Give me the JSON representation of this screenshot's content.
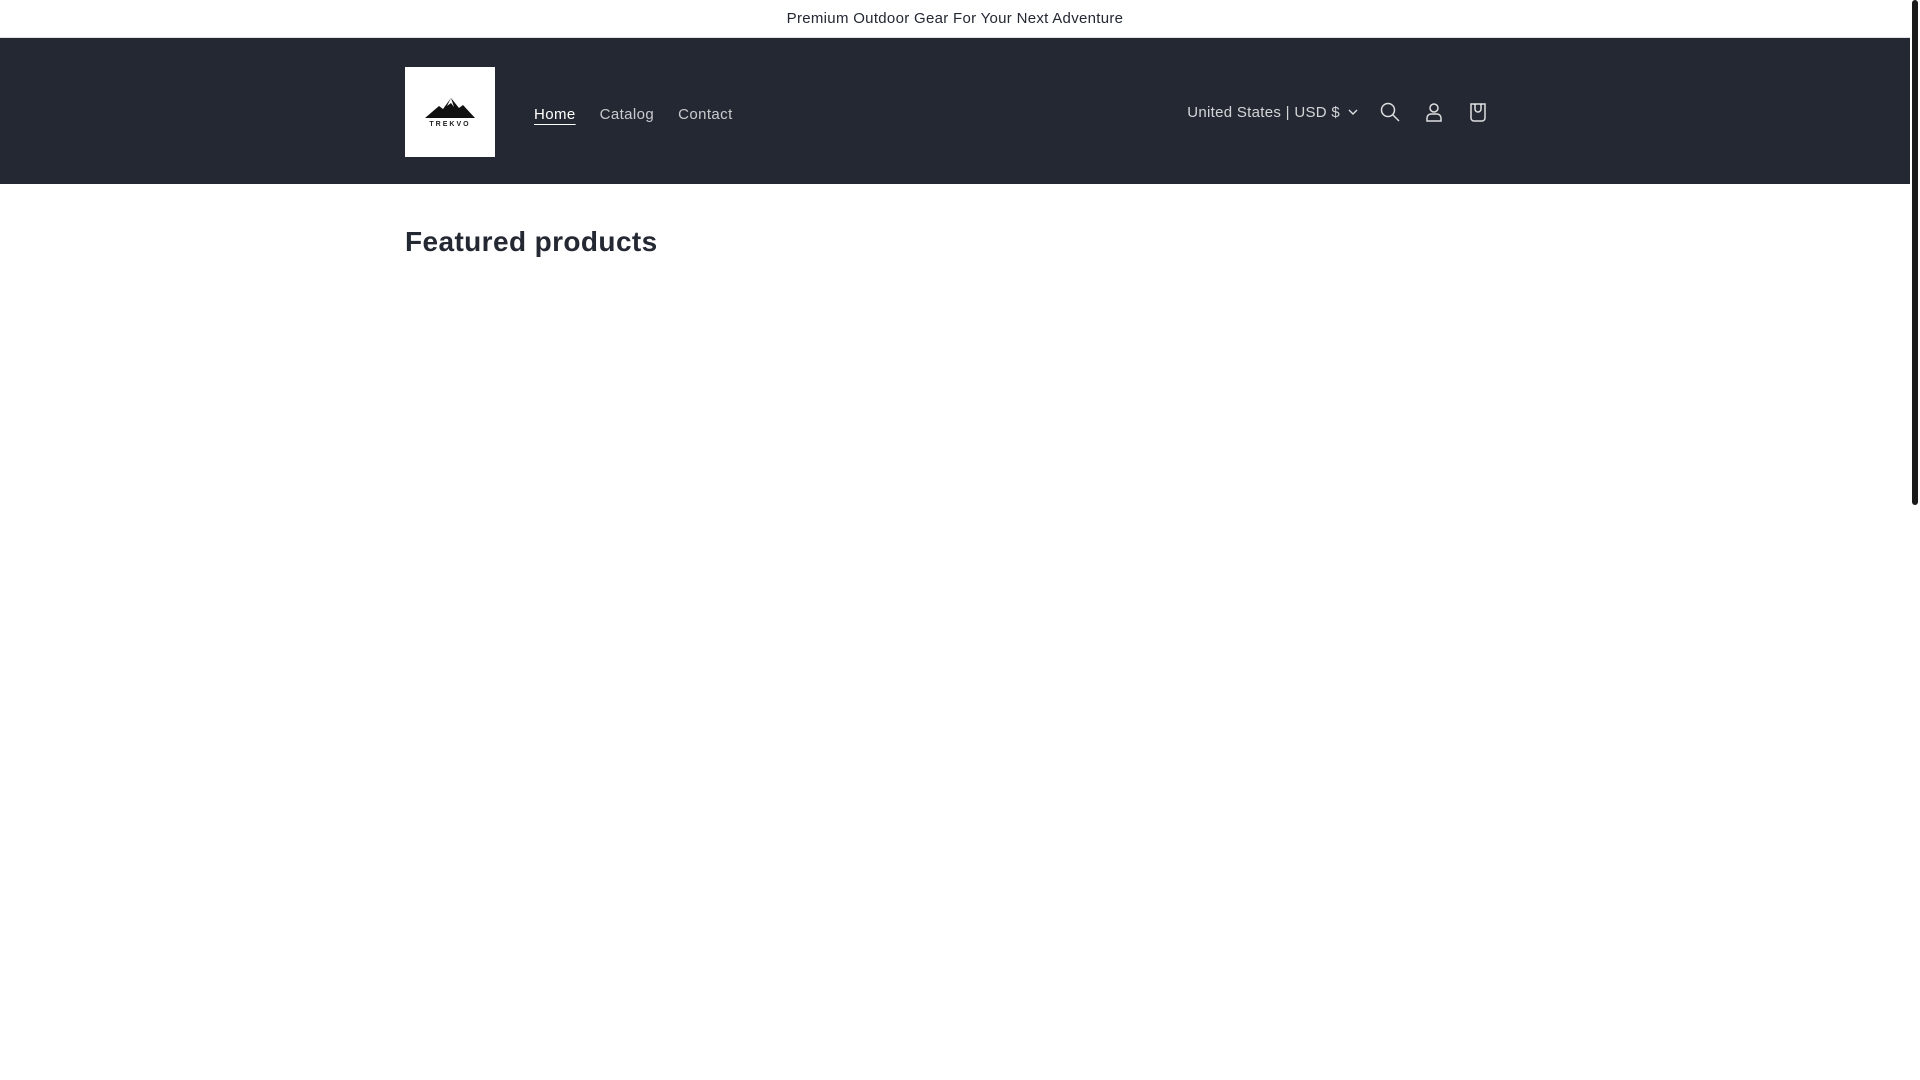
{
  "announcement": "Premium Outdoor Gear For Your Next Adventure",
  "logo": {
    "text": "TREKVO"
  },
  "nav": [
    {
      "label": "Home",
      "active": true
    },
    {
      "label": "Catalog"
    },
    {
      "label": "Contact"
    }
  ],
  "country_selector": "United States | USD $",
  "main": {
    "heading": "Featured products"
  }
}
